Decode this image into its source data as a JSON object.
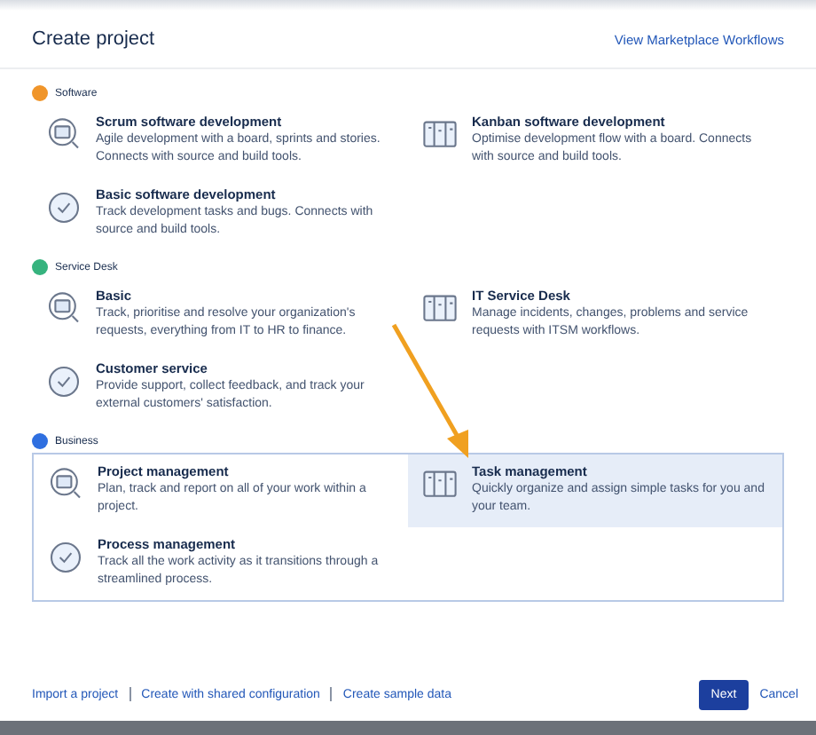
{
  "dialog": {
    "title": "Create project",
    "marketplace_link": "View Marketplace Workflows"
  },
  "sections": [
    {
      "name": "Software",
      "color": "#f0952a",
      "items": [
        {
          "title": "Scrum software development",
          "description": "Agile development with a board, sprints and stories. Connects with source and build tools.",
          "selected": false
        },
        {
          "title": "Kanban software development",
          "description": "Optimise development flow with a board. Connects with source and build tools.",
          "selected": false
        },
        {
          "title": "Basic software development",
          "description": "Track development tasks and bugs. Connects with source and build tools.",
          "selected": false
        }
      ]
    },
    {
      "name": "Service Desk",
      "color": "#36b37e",
      "items": [
        {
          "title": "Basic",
          "description": "Track, prioritise and resolve your organization's requests, everything from IT to HR to finance.",
          "selected": false
        },
        {
          "title": "IT Service Desk",
          "description": "Manage incidents, changes, problems and service requests with ITSM workflows.",
          "selected": false
        },
        {
          "title": "Customer service",
          "description": "Provide support, collect feedback, and track your external customers' satisfaction.",
          "selected": false
        }
      ]
    },
    {
      "name": "Business",
      "color": "#2f6fe0",
      "items": [
        {
          "title": "Project management",
          "description": "Plan, track and report on all of your work within a project.",
          "selected": false
        },
        {
          "title": "Task management",
          "description": "Quickly organize and assign simple tasks for you and your team.",
          "selected": true
        },
        {
          "title": "Process management",
          "description": "Track all the work activity as it transitions through a streamlined process.",
          "selected": false
        }
      ]
    }
  ],
  "footer": {
    "links": [
      "Import a project",
      "Create with shared configuration",
      "Create sample data"
    ],
    "primary_button": "Next",
    "cancel_button": "Cancel"
  }
}
